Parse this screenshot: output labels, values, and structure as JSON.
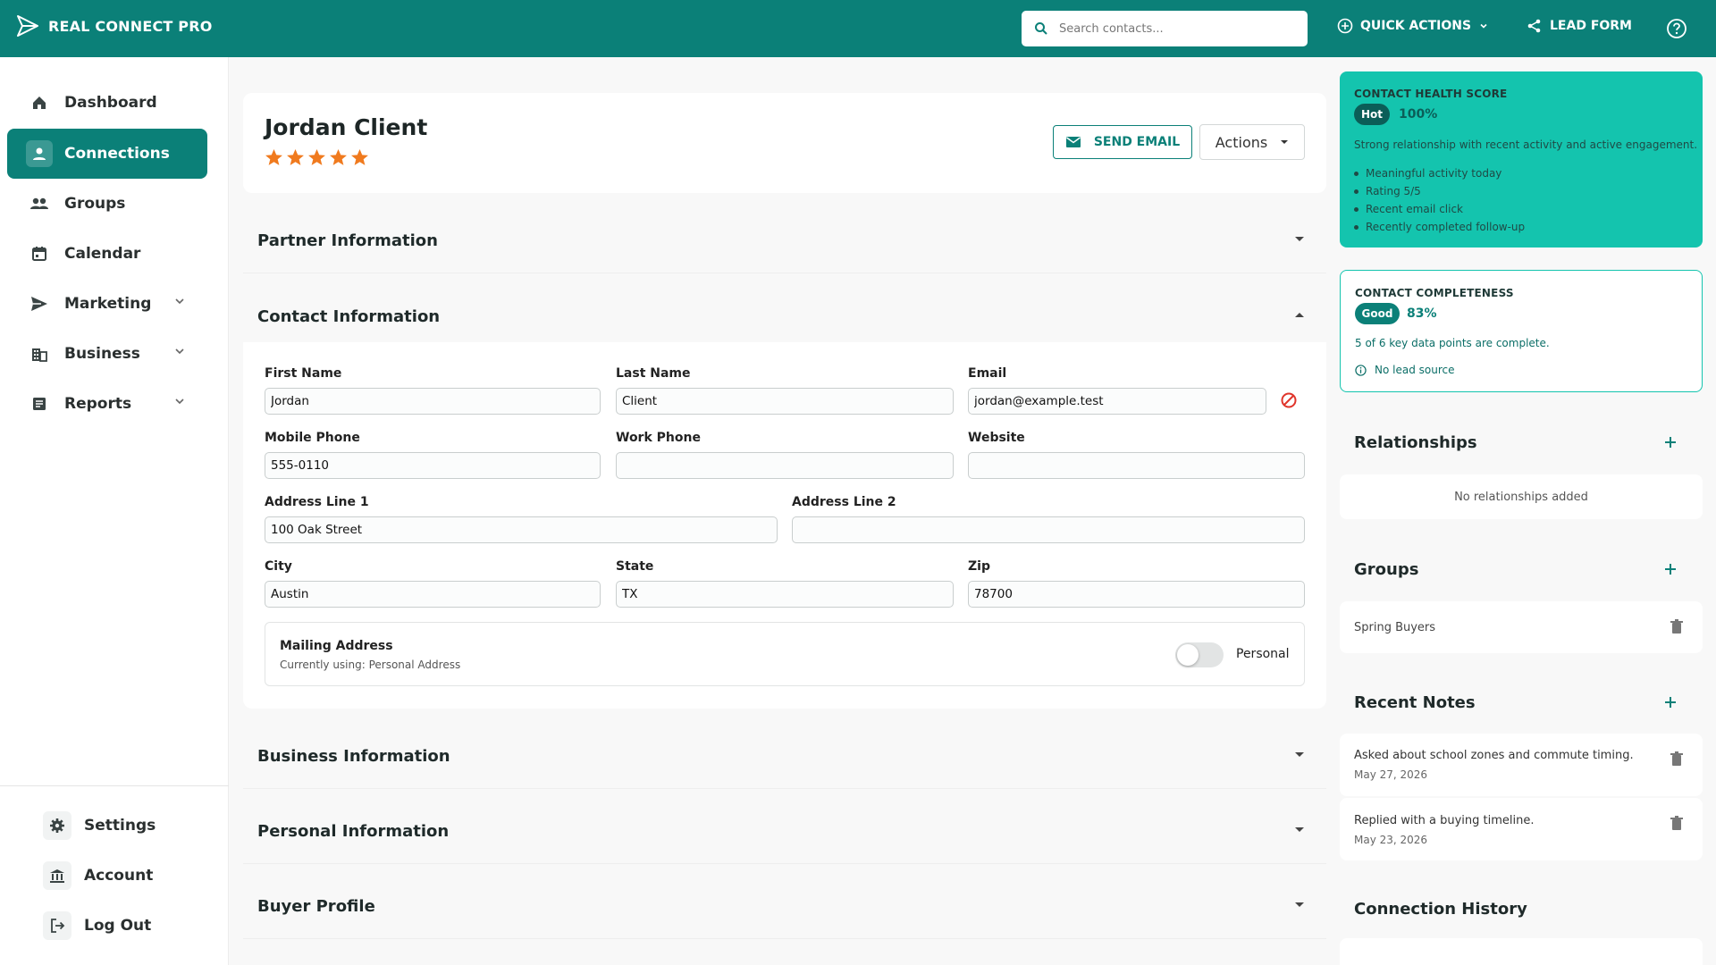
{
  "header": {
    "brand": "REAL CONNECT PRO",
    "search_placeholder": "Search contacts...",
    "quick_actions": "QUICK ACTIONS",
    "lead_form": "LEAD FORM",
    "accent": "#0b8078"
  },
  "sidebar": {
    "items": [
      {
        "label": "Dashboard",
        "icon": "home-icon"
      },
      {
        "label": "Connections",
        "icon": "person-icon",
        "active": true
      },
      {
        "label": "Groups",
        "icon": "people-icon"
      },
      {
        "label": "Calendar",
        "icon": "calendar-icon"
      },
      {
        "label": "Marketing",
        "icon": "send-icon",
        "expandable": true
      },
      {
        "label": "Business",
        "icon": "business-icon",
        "expandable": true
      },
      {
        "label": "Reports",
        "icon": "report-icon",
        "expandable": true
      }
    ],
    "bottom": [
      {
        "label": "Settings",
        "icon": "gear-icon"
      },
      {
        "label": "Account",
        "icon": "bank-icon"
      },
      {
        "label": "Log Out",
        "icon": "logout-icon"
      }
    ]
  },
  "contact": {
    "name": "Jordan Client",
    "rating": 5,
    "send_email": "SEND EMAIL",
    "actions": "Actions"
  },
  "sections": {
    "partner": "Partner Information",
    "contact": "Contact Information",
    "business": "Business Information",
    "personal": "Personal Information",
    "buyer": "Buyer Profile"
  },
  "fields": {
    "first_name": {
      "label": "First Name",
      "value": "Jordan"
    },
    "last_name": {
      "label": "Last Name",
      "value": "Client"
    },
    "email": {
      "label": "Email",
      "value": "jordan@example.test"
    },
    "mobile_phone": {
      "label": "Mobile Phone",
      "value": "555-0110"
    },
    "work_phone": {
      "label": "Work Phone",
      "value": ""
    },
    "website": {
      "label": "Website",
      "value": ""
    },
    "address1": {
      "label": "Address Line 1",
      "value": "100 Oak Street"
    },
    "address2": {
      "label": "Address Line 2",
      "value": ""
    },
    "city": {
      "label": "City",
      "value": "Austin"
    },
    "state": {
      "label": "State",
      "value": "TX"
    },
    "zip": {
      "label": "Zip",
      "value": "78700"
    }
  },
  "mailing": {
    "title": "Mailing Address",
    "subtitle": "Currently using: Personal Address",
    "toggle_label": "Personal",
    "toggle_on": false
  },
  "health": {
    "label": "CONTACT HEALTH SCORE",
    "badge": "Hot",
    "percent": "100%",
    "description": "Strong relationship with recent activity and active engagement.",
    "bullets": [
      "Meaningful activity today",
      "Rating 5/5",
      "Recent email click",
      "Recently completed follow-up"
    ],
    "color": "#14c4ae"
  },
  "completeness": {
    "label": "CONTACT COMPLETENESS",
    "badge": "Good",
    "percent": "83%",
    "description": "5 of 6 key data points are complete.",
    "missing": "No lead source"
  },
  "relationships": {
    "title": "Relationships",
    "empty": "No relationships added"
  },
  "groups": {
    "title": "Groups",
    "items": [
      "Spring Buyers"
    ]
  },
  "notes": {
    "title": "Recent Notes",
    "items": [
      {
        "text": "Asked about school zones and commute timing.",
        "date": "May 27, 2026"
      },
      {
        "text": "Replied with a buying timeline.",
        "date": "May 23, 2026"
      }
    ]
  },
  "history": {
    "title": "Connection History"
  }
}
